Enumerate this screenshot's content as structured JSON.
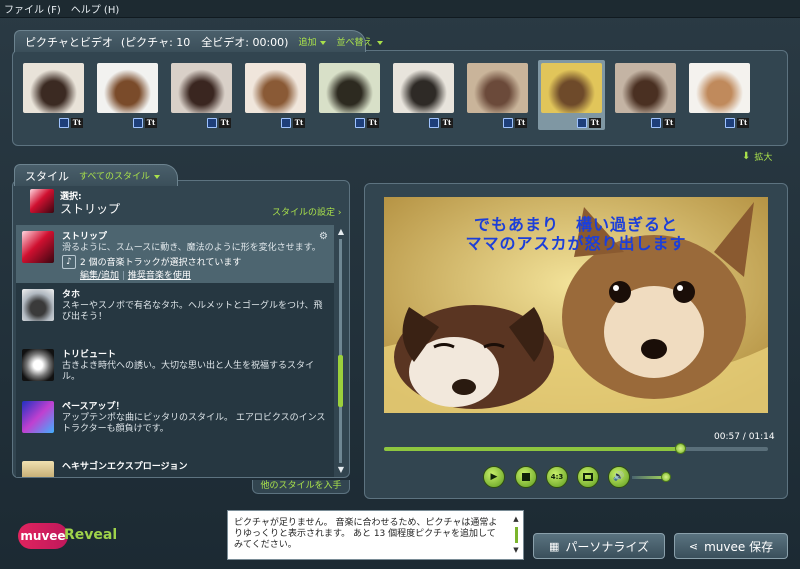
{
  "menu": [
    {
      "label": "ファイル (F)"
    },
    {
      "label": "ヘルプ (H)"
    }
  ],
  "pictures_panel": {
    "title": "ピクチャとビデオ",
    "info": "(ピクチャ: 10　全ビデオ: 00:00)",
    "add_label": "追加",
    "sort_label": "並べ替え",
    "expand_label": "拡大",
    "thumbnails": [
      {
        "name": "couple",
        "colors": [
          "#e9e3d9",
          "#3b2a22"
        ]
      },
      {
        "name": "puppy-brown",
        "colors": [
          "#f2f2f0",
          "#7a4b2a"
        ]
      },
      {
        "name": "puppy-crying",
        "colors": [
          "#d9d0c8",
          "#3a2620"
        ]
      },
      {
        "name": "puppy-sleeping",
        "colors": [
          "#f0e6dc",
          "#8a5a36"
        ]
      },
      {
        "name": "cat-plants",
        "colors": [
          "#d8e0c8",
          "#2d2a20"
        ]
      },
      {
        "name": "cat-window",
        "colors": [
          "#e8e4dc",
          "#2e2a26"
        ]
      },
      {
        "name": "puppies-bed",
        "colors": [
          "#c9b49a",
          "#6b4a3a"
        ]
      },
      {
        "name": "chihuahuas-yellow",
        "colors": [
          "#e1c55a",
          "#6e4a2a"
        ]
      },
      {
        "name": "puppies-sleeping",
        "colors": [
          "#c4b4a4",
          "#4a3022"
        ]
      },
      {
        "name": "rabbit",
        "colors": [
          "#f4f2ee",
          "#c08a5c"
        ]
      }
    ],
    "selected_index": 7
  },
  "style_panel": {
    "title": "スタイル",
    "filter_label": "すべてのスタイル",
    "selected_prefix": "選択:",
    "selected_name": "ストリップ",
    "settings_label": "スタイルの設定",
    "more_styles_label": "他のスタイルを入手",
    "items": [
      {
        "name": "ストリップ",
        "desc": "滑るように、スムースに動き、魔法のように形を変化させます。",
        "music_text": "2 個の音楽トラックが選択されています",
        "music_edit": "編集/追加",
        "music_recommended": "推奨音楽を使用"
      },
      {
        "name": "タホ",
        "desc": "スキーやスノボで有名なタホ。ヘルメットとゴーグルをつけ、飛び出そう！"
      },
      {
        "name": "トリビュート",
        "desc": "古きよき時代への誘い。大切な思い出と人生を祝福するスタイル。"
      },
      {
        "name": "ペースアップ！",
        "desc": "アップテンポな曲にピッタリのスタイル。 エアロビクスのインストラクターも顔負けです。"
      },
      {
        "name": "ヘキサゴンエクスプロージョン",
        "desc": ""
      }
    ]
  },
  "preview": {
    "caption_line1": "でもあまり　構い過ぎると",
    "caption_line2": "ママのアスカが怒り出します",
    "time_text": "00:57 / 01:14",
    "progress": 0.77,
    "volume": 0.85,
    "ratio_label": "4:3"
  },
  "message": {
    "text": "ピクチャが足りません。 音楽に合わせるため、ピクチャは通常よりゆっくりと表示されます。 あと 13 個程度ピクチャを追加してみてください。"
  },
  "buttons": {
    "personalize": "パーソナライズ",
    "save": "muvee 保存"
  },
  "logo": {
    "muvee": "muvee",
    "reveal": "Reveal"
  }
}
